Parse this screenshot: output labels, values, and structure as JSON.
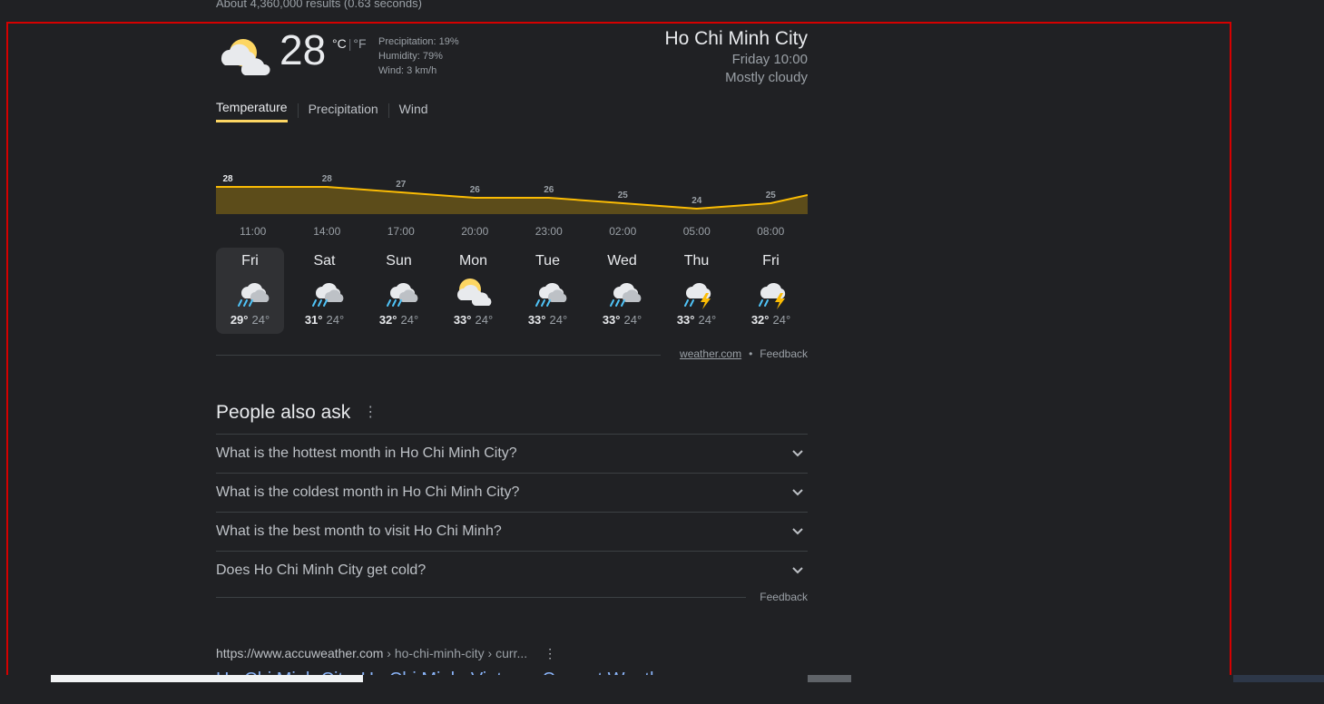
{
  "results_count": "About 4,360,000 results (0.63 seconds)",
  "weather": {
    "current_temp": "28",
    "unit_c": "°C",
    "unit_sep": "|",
    "unit_f": "°F",
    "precipitation": "Precipitation: 19%",
    "humidity": "Humidity: 79%",
    "wind": "Wind: 3 km/h",
    "location": "Ho Chi Minh City",
    "datetime": "Friday 10:00",
    "condition": "Mostly cloudy",
    "current_icon": "sun-behind-cloud-icon",
    "tabs": [
      "Temperature",
      "Precipitation",
      "Wind"
    ],
    "active_tab": "Temperature",
    "accent_color": "#fdd663"
  },
  "chart_data": {
    "type": "area",
    "points": [
      {
        "label": "28",
        "value": 28
      },
      {
        "label": "28",
        "value": 28
      },
      {
        "label": "27",
        "value": 27
      },
      {
        "label": "26",
        "value": 26
      },
      {
        "label": "26",
        "value": 26
      },
      {
        "label": "25",
        "value": 25
      },
      {
        "label": "24",
        "value": 24
      },
      {
        "label": "25",
        "value": 25
      }
    ],
    "x_ticks": [
      "11:00",
      "14:00",
      "17:00",
      "20:00",
      "23:00",
      "02:00",
      "05:00",
      "08:00"
    ],
    "line_color": "#fbbc04",
    "fill_color": "#5c4c1a"
  },
  "forecast": [
    {
      "day": "Fri",
      "hi": "29°",
      "lo": "24°",
      "icon": "rain-cloud-icon"
    },
    {
      "day": "Sat",
      "hi": "31°",
      "lo": "24°",
      "icon": "rain-cloud-icon"
    },
    {
      "day": "Sun",
      "hi": "32°",
      "lo": "24°",
      "icon": "rain-cloud-icon"
    },
    {
      "day": "Mon",
      "hi": "33°",
      "lo": "24°",
      "icon": "sun-behind-cloud-icon"
    },
    {
      "day": "Tue",
      "hi": "33°",
      "lo": "24°",
      "icon": "rain-cloud-icon"
    },
    {
      "day": "Wed",
      "hi": "33°",
      "lo": "24°",
      "icon": "rain-cloud-icon"
    },
    {
      "day": "Thu",
      "hi": "33°",
      "lo": "24°",
      "icon": "thunderstorm-icon"
    },
    {
      "day": "Fri",
      "hi": "32°",
      "lo": "24°",
      "icon": "thunderstorm-icon"
    }
  ],
  "source": {
    "link": "weather.com",
    "separator": "•",
    "feedback": "Feedback"
  },
  "paa": {
    "title": "People also ask",
    "menu": "⋮",
    "questions": [
      "What is the hottest month in Ho Chi Minh City?",
      "What is the coldest month in Ho Chi Minh City?",
      "What is the best month to visit Ho Chi Minh?",
      "Does Ho Chi Minh City get cold?"
    ],
    "feedback": "Feedback"
  },
  "accuweather": {
    "url": "https://www.accuweather.com",
    "path": " › ho-chi-minh-city › curr...",
    "menu": "⋮",
    "title": "Ho Chi Minh City, Ho Chi Minh, Vietnam Current Weather"
  }
}
